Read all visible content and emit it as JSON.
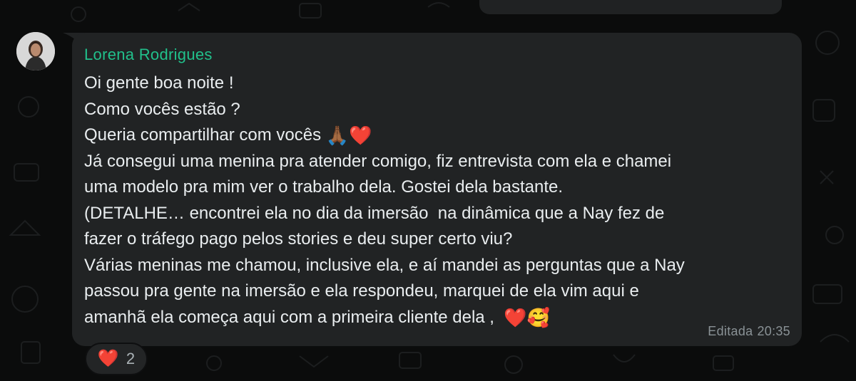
{
  "previous_bubble": {
    "visible": true
  },
  "message": {
    "sender": "Lorena Rodrigues",
    "lines": [
      "Oi gente boa noite !",
      "Como vocês estão ?",
      "Queria compartilhar com vocês ",
      "Já consegui uma menina pra atender comigo, fiz entrevista com ela e chamei",
      "uma modelo pra mim ver o trabalho dela. Gostei dela bastante.",
      "(DETALHE… encontrei ela no dia da imersão  na dinâmica que a Nay fez de",
      "fazer o tráfego pago pelos stories e deu super certo viu?",
      "Várias meninas me chamou, inclusive ela, e aí mandei as perguntas que a Nay",
      "passou pra gente na imersão e ela respondeu, marquei de ela vim aqui e",
      "amanhã ela começa aqui com a primeira cliente dela ,  "
    ],
    "line3_emojis": "🙏🏾❤️",
    "line10_emojis": "❤️🥰",
    "edited_label": "Editada",
    "time": "20:35"
  },
  "reaction": {
    "emoji": "❤️",
    "count": "2"
  },
  "colors": {
    "sender": "#21c08b",
    "bubble": "#212324",
    "text": "#e9edef",
    "meta": "#8a9296"
  }
}
